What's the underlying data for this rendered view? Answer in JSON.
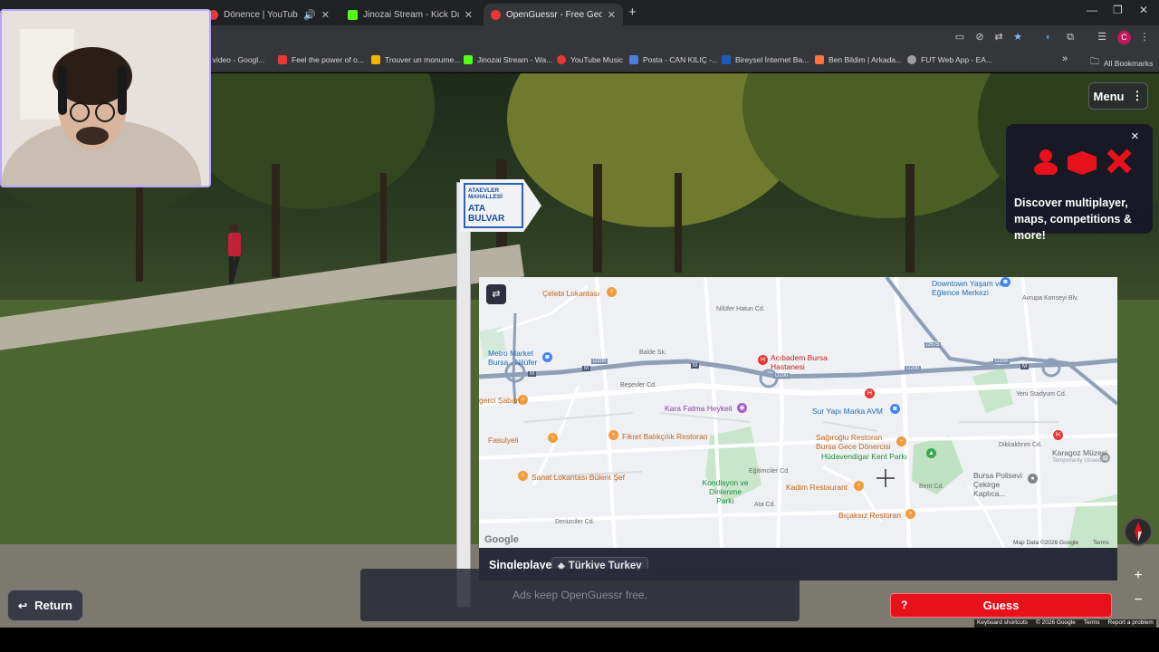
{
  "browser": {
    "tabs": [
      {
        "title": "Dönence | YouTube Music",
        "color": "#e53935",
        "active": false
      },
      {
        "title": "Jinozai Stream - Kick Dashboar",
        "color": "#53fc18",
        "active": false
      },
      {
        "title": "OpenGuessr - Free GeoGuessr A",
        "color": "#e53935",
        "active": true
      }
    ],
    "new_tab": "+",
    "profile_initial": "C",
    "bookmarks": [
      {
        "title": "z video - Googl...",
        "color": "#4285f4"
      },
      {
        "title": "Feel the power of o...",
        "color": "#e53935"
      },
      {
        "title": "Trouver un monume...",
        "color": "#f4b400"
      },
      {
        "title": "Jinozai Stream - Wa...",
        "color": "#53fc18"
      },
      {
        "title": "YouTube Music",
        "color": "#e53935"
      },
      {
        "title": "Posta - CAN KILIÇ -...",
        "color": "#4a7fd6"
      },
      {
        "title": "Bireysel İnternet Ba...",
        "color": "#1e5bb8"
      },
      {
        "title": "Ben Bildim | Arkada...",
        "color": "#ff7043"
      },
      {
        "title": "FUT Web App - EA...",
        "color": "#9e9e9e"
      }
    ],
    "all_bookmarks": "All Bookmarks",
    "more": "»"
  },
  "street": {
    "sign_top": "ATAEVLER MAHALLESİ",
    "sign_main": "ATA BULVAR"
  },
  "menu": {
    "label": "Menu",
    "icon": "⋮"
  },
  "promo": {
    "text": "Discover multiplayer, maps, competitions & more!",
    "close": "×"
  },
  "map": {
    "labels": [
      {
        "text": "Çelebi Lokantası",
        "color": "#c5651b"
      },
      {
        "text": "Metro Market Bursa - Nilüfer",
        "color": "#1e6fb4"
      },
      {
        "text": "Acıbadem Bursa Hastanesi",
        "color": "#c5221f"
      },
      {
        "text": "Kara Fatma Heykeli",
        "color": "#8d3fa8"
      },
      {
        "text": "Sur Yapı Marka AVM",
        "color": "#1e6fb4"
      },
      {
        "text": "Fikret Balıkçılık Restoran",
        "color": "#c5651b"
      },
      {
        "text": "Fasulyeli",
        "color": "#c5651b"
      },
      {
        "text": "Sağıroğlu Restoran Bursa Gece Dönercisi",
        "color": "#c5651b"
      },
      {
        "text": "Hüdavendigar Kent Parkı",
        "color": "#1e8e3e"
      },
      {
        "text": "Sanat Lokantası Bülent Şef",
        "color": "#c5651b"
      },
      {
        "text": "Kondisyon ve Dinlenme Parkı",
        "color": "#1e8e3e"
      },
      {
        "text": "Kadim Restaurant",
        "color": "#c5651b"
      },
      {
        "text": "Bıçaksız Restoran",
        "color": "#c5651b"
      },
      {
        "text": "Bursa Polisevi Çekirge Kaplıca...",
        "color": "#5f6368"
      },
      {
        "text": "Karagoz Müzesi",
        "color": "#5f6368"
      },
      {
        "text": "Temporarily closed",
        "color": "#9aa0a6"
      },
      {
        "text": "Downtown Yaşam ve Eğlence Merkezi",
        "color": "#1e6fb4"
      },
      {
        "text": "Nilüfer Hatun Cd.",
        "color": "#6b6b6b"
      },
      {
        "text": "Beşevler Cd.",
        "color": "#6b6b6b"
      },
      {
        "text": "Balde Sk.",
        "color": "#6b6b6b"
      },
      {
        "text": "Dikkaldırım Cd.",
        "color": "#6b6b6b"
      },
      {
        "text": "Eğitimciler Cd.",
        "color": "#6b6b6b"
      },
      {
        "text": "Bent Cd.",
        "color": "#6b6b6b"
      },
      {
        "text": "Denizciler Cd.",
        "color": "#6b6b6b"
      },
      {
        "text": "Ata Cd.",
        "color": "#6b6b6b"
      },
      {
        "text": "gerci Şaban",
        "color": "#c5651b"
      },
      {
        "text": "Yeni Stadyum Cd.",
        "color": "#6b6b6b"
      },
      {
        "text": "Avrupa Konseyi Blv.",
        "color": "#6b6b6b"
      }
    ],
    "road_badges": [
      "D200",
      "D200",
      "D200",
      "D200",
      "D575",
      "M",
      "M",
      "M",
      "M"
    ],
    "attribution": "Map Data ©2026 Google",
    "terms": "Terms",
    "google_logo": "Google"
  },
  "footer_bar": {
    "mode": "Singleplayer",
    "country": "Türkiye Turkey"
  },
  "ads_text": "Ads keep OpenGuessr free.",
  "return_label": "Return",
  "guess": {
    "label": "Guess",
    "hint": "?"
  },
  "zoom": {
    "in": "+",
    "out": "−"
  },
  "google_footer": [
    "Keyboard shortcuts",
    "© 2026 Google",
    "Terms",
    "Report a problem"
  ]
}
